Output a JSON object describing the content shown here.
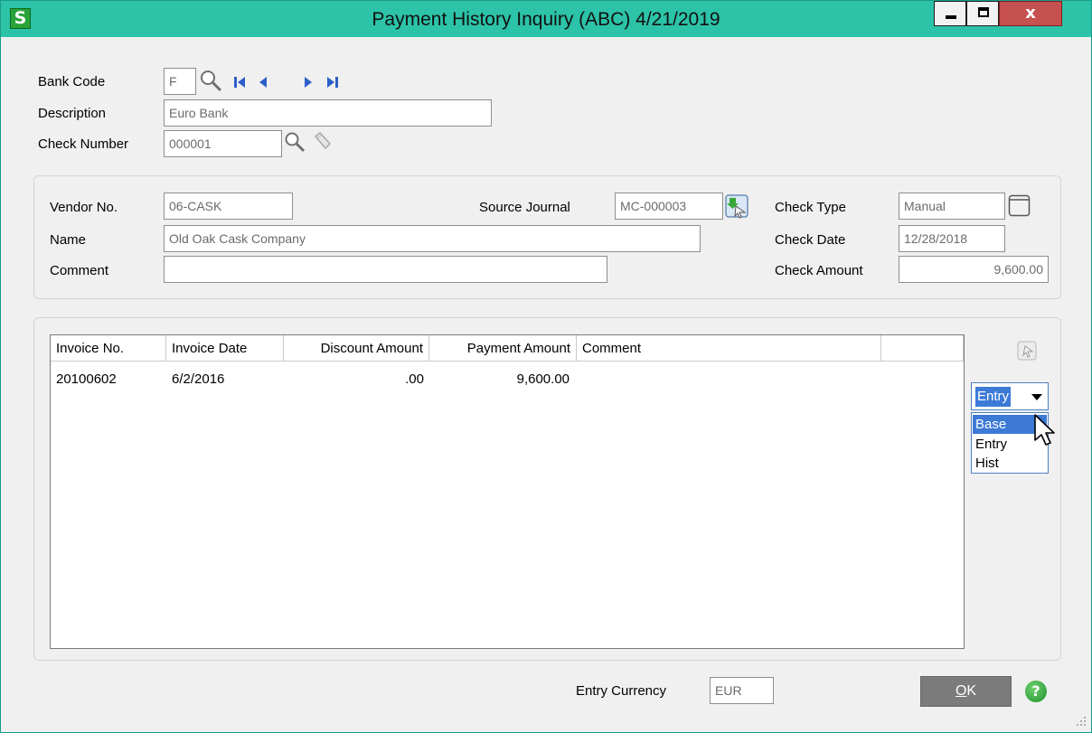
{
  "window": {
    "title": "Payment History Inquiry (ABC) 4/21/2019",
    "app_logo": "S",
    "close_glyph": "x"
  },
  "header": {
    "bank_code_label": "Bank Code",
    "bank_code_value": "F",
    "description_label": "Description",
    "description_value": "Euro Bank",
    "check_number_label": "Check Number",
    "check_number_value": "000001"
  },
  "details": {
    "vendor_no_label": "Vendor No.",
    "vendor_no_value": "06-CASK",
    "name_label": "Name",
    "name_value": "Old Oak Cask Company",
    "comment_label": "Comment",
    "comment_value": "",
    "source_journal_label": "Source Journal",
    "source_journal_value": "MC-000003",
    "check_type_label": "Check Type",
    "check_type_value": "Manual",
    "check_date_label": "Check Date",
    "check_date_value": "12/28/2018",
    "check_amount_label": "Check Amount",
    "check_amount_value": "9,600.00"
  },
  "grid": {
    "columns": [
      "Invoice No.",
      "Invoice Date",
      "Discount Amount",
      "Payment Amount",
      "Comment"
    ],
    "rows": [
      {
        "invoice_no": "20100602",
        "invoice_date": "6/2/2016",
        "discount_amount": ".00",
        "payment_amount": "9,600.00",
        "comment": ""
      }
    ]
  },
  "currency_dropdown": {
    "selected": "Entry",
    "options": [
      "Base",
      "Entry",
      "Hist"
    ],
    "highlighted": "Base"
  },
  "footer": {
    "entry_currency_label": "Entry Currency",
    "entry_currency_value": "EUR",
    "ok_label_u": "O",
    "ok_label_rest": "K",
    "help_glyph": "?"
  },
  "colors": {
    "titlebar": "#2cc3a8",
    "close": "#c75050",
    "selection": "#3c7ad6",
    "ok_button": "#7b7b7b"
  }
}
